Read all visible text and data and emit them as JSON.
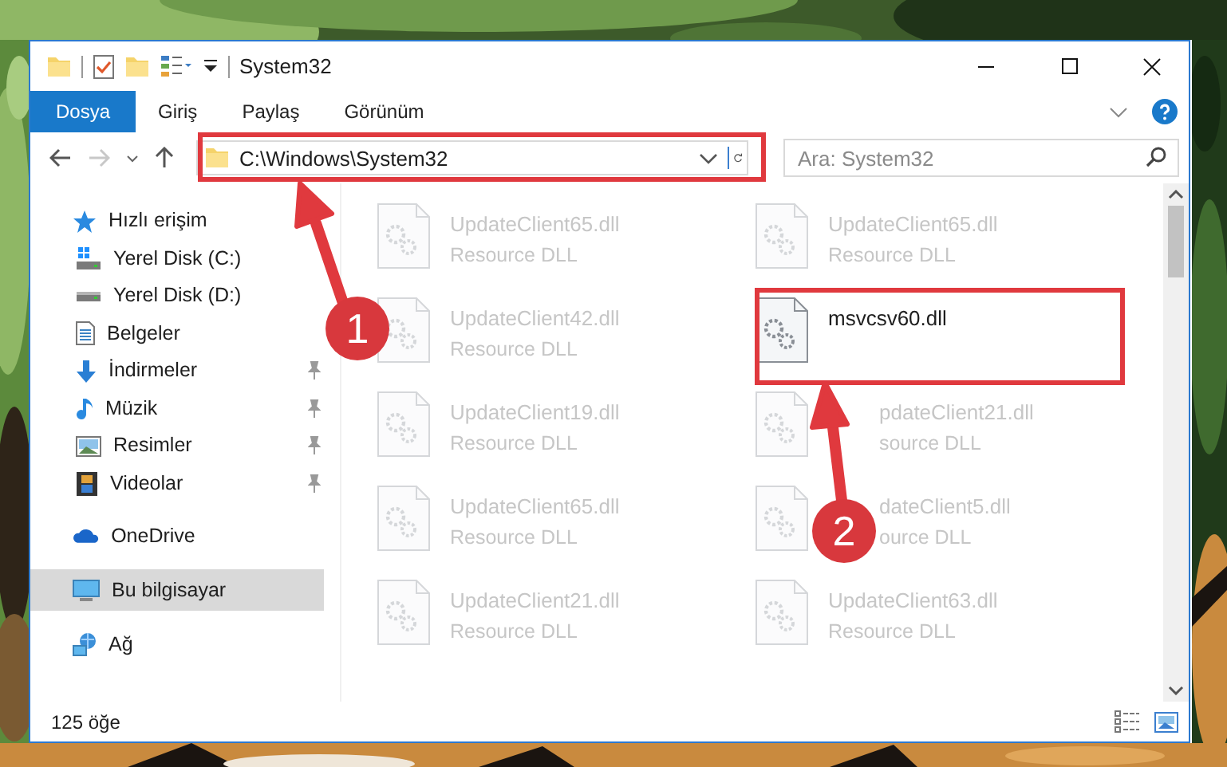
{
  "window": {
    "title": "System32"
  },
  "ribbon_tabs": [
    {
      "label": "Dosya",
      "selected": true
    },
    {
      "label": "Giriş",
      "selected": false
    },
    {
      "label": "Paylaş",
      "selected": false
    },
    {
      "label": "Görünüm",
      "selected": false
    }
  ],
  "address": {
    "path": "C:\\Windows\\System32"
  },
  "search": {
    "placeholder": "Ara: System32"
  },
  "navigation": [
    {
      "label": "Hızlı erişim",
      "kind": "star",
      "selected": false,
      "children": [
        {
          "label": "Yerel Disk (C:)",
          "kind": "drive-windows",
          "pinned": false,
          "selected": false
        },
        {
          "label": "Yerel Disk (D:)",
          "kind": "drive",
          "pinned": false,
          "selected": false
        },
        {
          "label": "Belgeler",
          "kind": "documents",
          "pinned": false,
          "selected": false
        },
        {
          "label": "İndirmeler",
          "kind": "download",
          "pinned": true,
          "selected": false
        },
        {
          "label": "Müzik",
          "kind": "music",
          "pinned": true,
          "selected": false
        },
        {
          "label": "Resimler",
          "kind": "pictures",
          "pinned": true,
          "selected": false
        },
        {
          "label": "Videolar",
          "kind": "videos",
          "pinned": true,
          "selected": false
        }
      ]
    },
    {
      "label": "OneDrive",
      "kind": "cloud",
      "selected": false
    },
    {
      "label": "Bu bilgisayar",
      "kind": "computer",
      "selected": true
    },
    {
      "label": "Ağ",
      "kind": "network",
      "selected": false
    }
  ],
  "files": [
    {
      "name": "UpdateClient65.dll",
      "type": "Resource DLL",
      "dimmed": true
    },
    {
      "name": "UpdateClient65.dll",
      "type": "Resource DLL",
      "dimmed": true
    },
    {
      "name": "UpdateClient42.dll",
      "type": "Resource DLL",
      "dimmed": true
    },
    {
      "name": "msvcsv60.dll",
      "dimmed": false
    },
    {
      "name": "UpdateClient19.dll",
      "type": "Resource DLL",
      "dimmed": true
    },
    {
      "name": "pdateClient21.dll",
      "type": "source DLL",
      "dimmed": true,
      "covered": true
    },
    {
      "name": "UpdateClient65.dll",
      "type": "Resource DLL",
      "dimmed": true
    },
    {
      "name": "dateClient5.dll",
      "type": "ource DLL",
      "dimmed": true,
      "covered": true
    },
    {
      "name": "UpdateClient21.dll",
      "type": "Resource DLL",
      "dimmed": true
    },
    {
      "name": "UpdateClient63.dll",
      "type": "Resource DLL",
      "dimmed": true
    }
  ],
  "status_bar": {
    "count": "125 öğe"
  },
  "callouts": [
    {
      "number": "1"
    },
    {
      "number": "2"
    }
  ]
}
